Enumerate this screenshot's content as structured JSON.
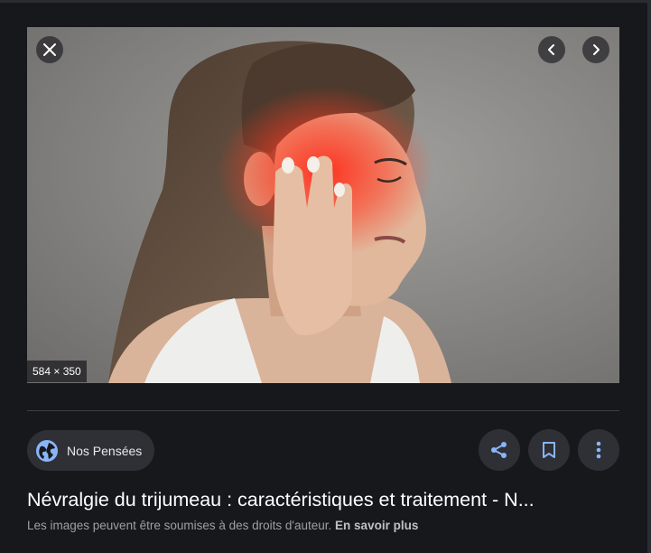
{
  "image": {
    "dimensions": "584 × 350"
  },
  "controls": {
    "close_icon": "close-icon",
    "prev_icon": "chevron-left-icon",
    "next_icon": "chevron-right-icon"
  },
  "source": {
    "name": "Nos Pensées",
    "icon": "globe-icon"
  },
  "actions": {
    "share_icon": "share-icon",
    "save_icon": "bookmark-icon",
    "more_icon": "more-vert-icon"
  },
  "title": "Névralgie du trijumeau : caractéristiques et traitement - N...",
  "notice": {
    "text": "Les images peuvent être soumises à des droits d'auteur.",
    "link": "En savoir plus"
  },
  "colors": {
    "background": "#17181c",
    "chip": "#2e3035",
    "accent_icon": "#8ab4f8"
  }
}
